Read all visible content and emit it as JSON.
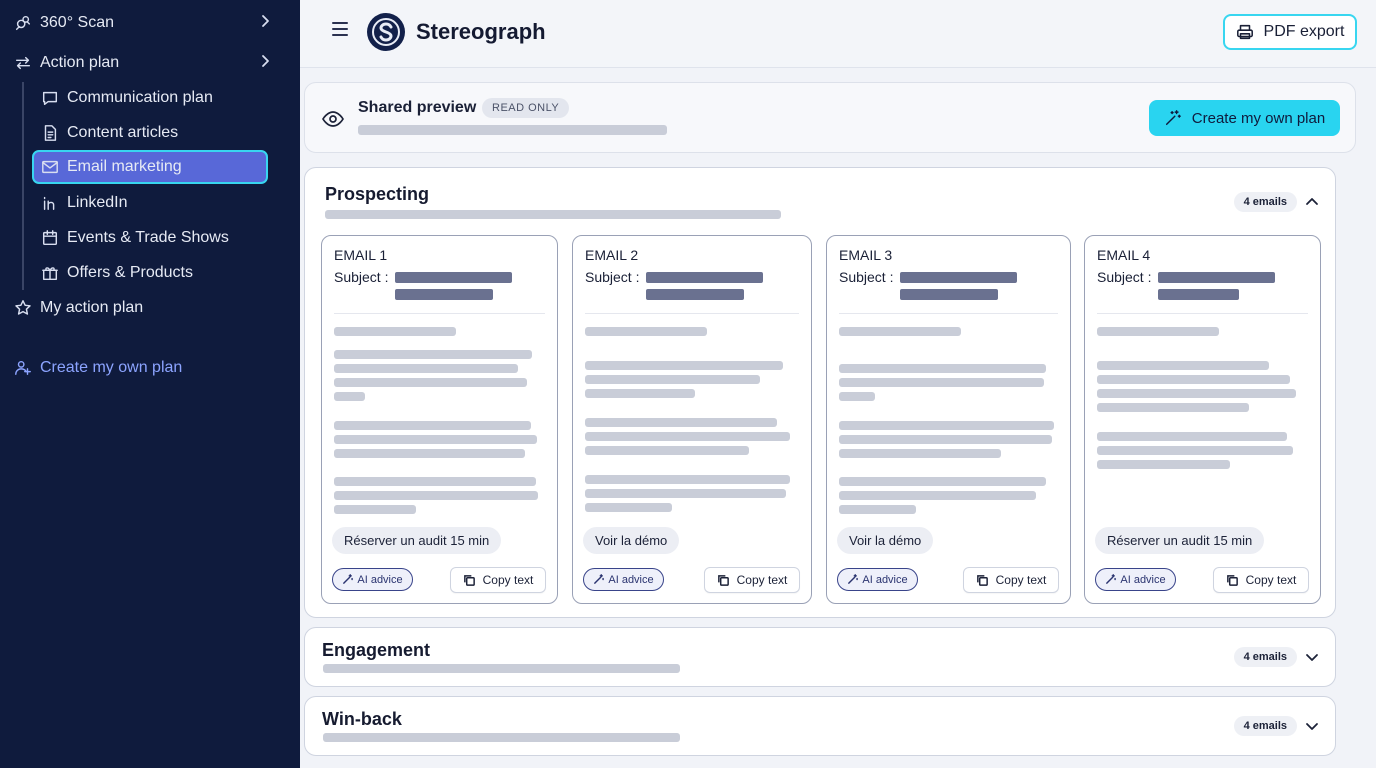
{
  "sidebar": {
    "items": [
      {
        "label": "360° Scan",
        "icon": "scan-icon"
      },
      {
        "label": "Action plan",
        "icon": "swap-arrows-icon"
      }
    ],
    "subitems": [
      {
        "label": "Communication plan",
        "icon": "chat-bubble-icon"
      },
      {
        "label": "Content articles",
        "icon": "document-icon"
      },
      {
        "label": "Email marketing",
        "icon": "mail-icon",
        "active": true
      },
      {
        "label": "LinkedIn",
        "icon": "linkedin-icon"
      },
      {
        "label": "Events & Trade Shows",
        "icon": "calendar-icon"
      },
      {
        "label": "Offers & Products",
        "icon": "gift-icon"
      }
    ],
    "my_action_plan": "My action plan",
    "create_own_plan": "Create my own plan"
  },
  "header": {
    "brand": "Stereograph",
    "pdf_export": "PDF export"
  },
  "preview": {
    "title": "Shared preview",
    "badge": "READ ONLY",
    "create_button": "Create my own plan"
  },
  "sections": [
    {
      "title": "Prospecting",
      "count": "4 emails",
      "expanded": true,
      "emails": [
        {
          "label": "EMAIL 1",
          "subject_label": "Subject :",
          "cta": "Réserver un audit 15 min",
          "ai": "AI advice",
          "copy": "Copy text"
        },
        {
          "label": "EMAIL 2",
          "subject_label": "Subject :",
          "cta": "Voir la démo",
          "ai": "AI advice",
          "copy": "Copy text"
        },
        {
          "label": "EMAIL 3",
          "subject_label": "Subject :",
          "cta": "Voir la démo",
          "ai": "AI advice",
          "copy": "Copy text"
        },
        {
          "label": "EMAIL 4",
          "subject_label": "Subject :",
          "cta": "Réserver un audit 15 min",
          "ai": "AI advice",
          "copy": "Copy text"
        }
      ]
    },
    {
      "title": "Engagement",
      "count": "4 emails",
      "expanded": false
    },
    {
      "title": "Win-back",
      "count": "4 emails",
      "expanded": false
    }
  ],
  "colors": {
    "sidebar_bg": "#0f1b3d",
    "accent_cyan": "#29d4f0",
    "active_item": "#5868d8",
    "create_link": "#8ca4ff"
  }
}
